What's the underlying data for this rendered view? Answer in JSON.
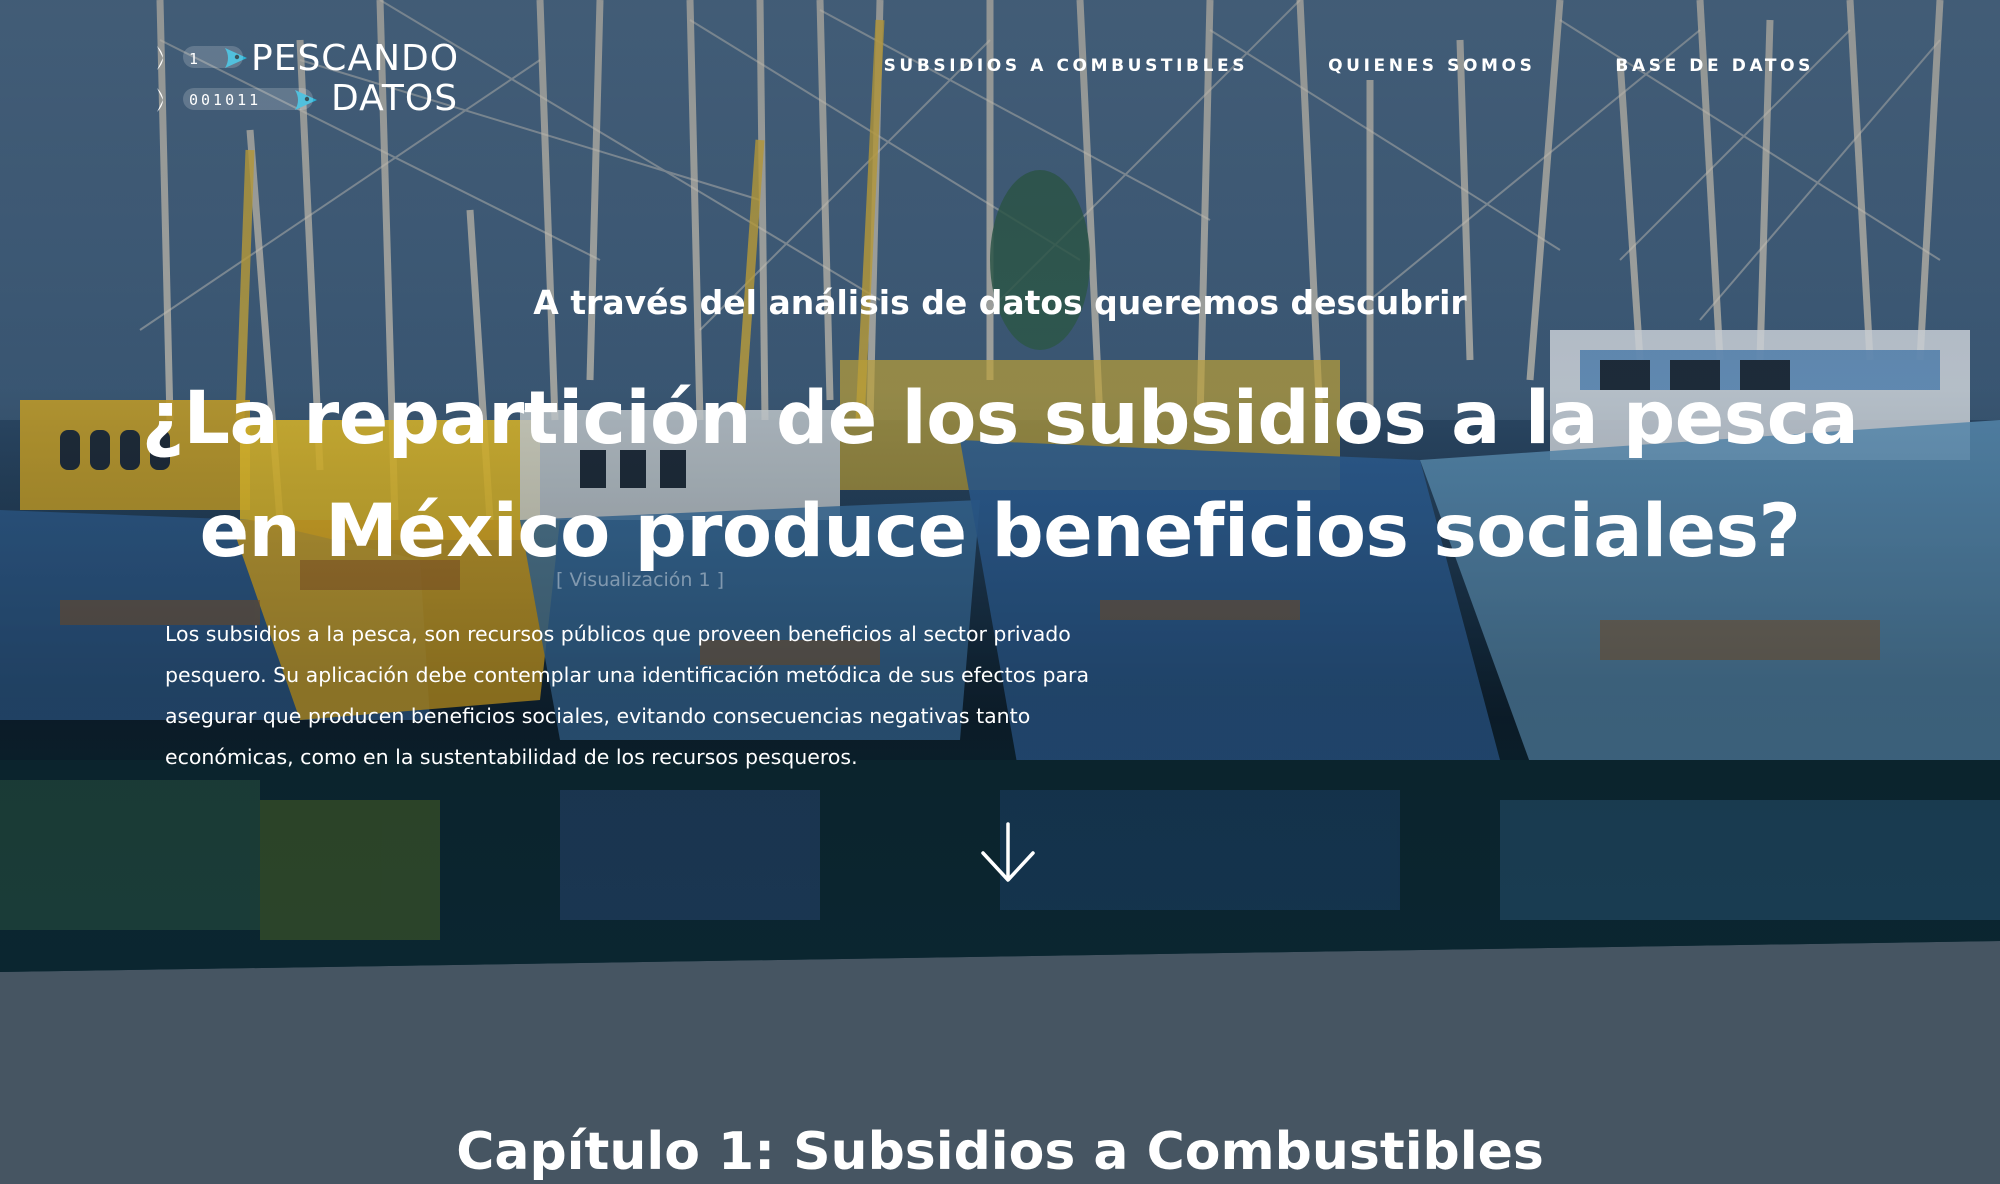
{
  "logo": {
    "line1": "PESCANDO",
    "line2": "DATOS",
    "code1": "1",
    "code2": "001011",
    "accent_color": "#2bb3d6"
  },
  "nav": {
    "items": [
      {
        "label": "SUBSIDIOS A COMBUSTIBLES"
      },
      {
        "label": "QUIENES SOMOS"
      },
      {
        "label": "BASE DE DATOS"
      }
    ]
  },
  "hero": {
    "subtitle": "A través del análisis de datos queremos descubrir",
    "title": "¿La repartición de los subsidios a la pesca en México produce beneficios sociales?",
    "viz_link": "[ Visualización 1 ]",
    "intro": "Los subsidios a la pesca, son recursos públicos que proveen beneficios al sector privado pesquero. Su aplicación debe contemplar una identificación metódica de sus efectos para asegurar que producen beneficios sociales, evitando consecuencias negativas tanto económicas, como en la sustentabilidad de los recursos pesqueros.",
    "scroll_icon": "arrow-down-icon"
  },
  "chapter": {
    "title": "Capítulo 1: Subsidios a Combustibles"
  },
  "colors": {
    "section_background": "#465562",
    "text": "#ffffff"
  }
}
